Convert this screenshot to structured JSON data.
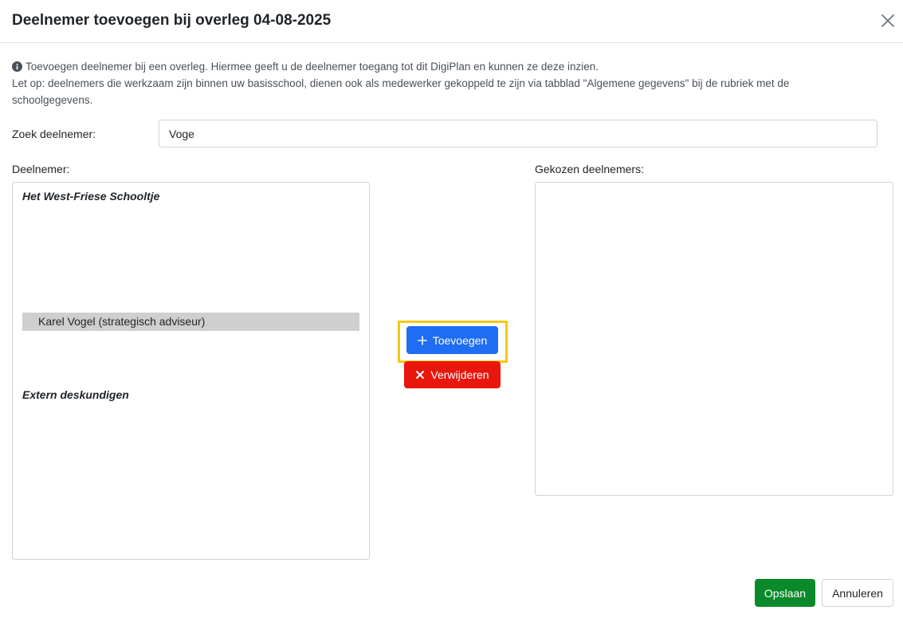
{
  "dialog": {
    "title": "Deelnemer toevoegen bij overleg 04-08-2025",
    "close_icon": "close-icon"
  },
  "info": {
    "icon": "info-icon",
    "line1": "Toevoegen deelnemer bij een overleg. Hiermee geeft u de deelnemer toegang tot dit DigiPlan en kunnen ze deze inzien.",
    "line2": "Let op: deelnemers die werkzaam zijn binnen uw basisschool, dienen ook als medewerker gekoppeld te zijn via tabblad \"Algemene gegevens\" bij de rubriek met de",
    "line3": "schoolgegevens."
  },
  "search": {
    "label": "Zoek deelnemer:",
    "value": "Voge"
  },
  "available": {
    "label": "Deelnemer:",
    "groups": [
      {
        "heading": "Het West-Friese Schooltje",
        "items": [
          "Karel Vogel (strategisch adviseur)"
        ]
      },
      {
        "heading": "Extern deskundigen",
        "items": []
      }
    ]
  },
  "selected": {
    "label": "Gekozen deelnemers:",
    "items": []
  },
  "actions": {
    "add_label": "Toevoegen",
    "add_icon": "plus-icon",
    "remove_label": "Verwijderen",
    "remove_icon": "times-icon"
  },
  "footer": {
    "save_label": "Opslaan",
    "cancel_label": "Annuleren"
  },
  "colors": {
    "primary": "#1f6df2",
    "danger": "#e8160c",
    "success": "#0a8a2a",
    "highlight": "#f6c90e",
    "selected_item_bg": "#cfcfcf"
  }
}
